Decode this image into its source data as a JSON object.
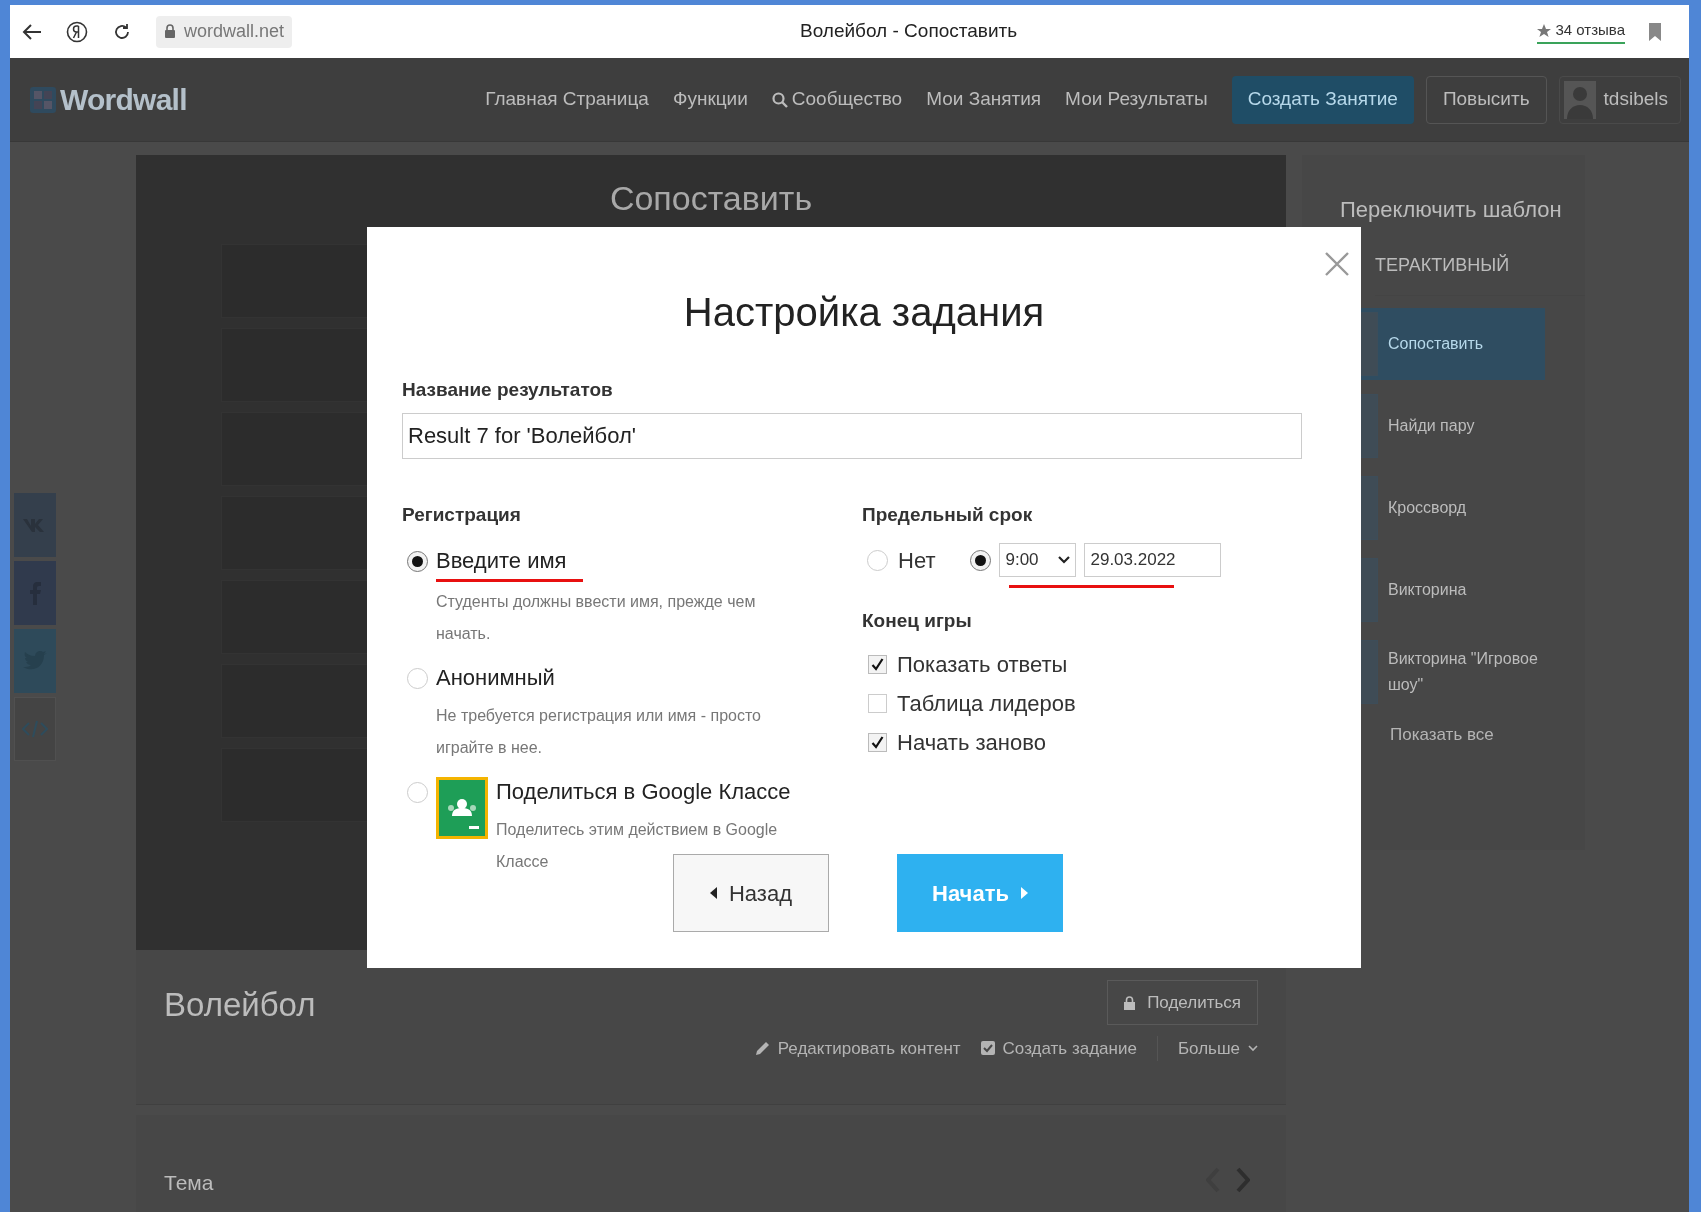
{
  "browser": {
    "address": "wordwall.net",
    "tab_title": "Волейбол - Сопоставить",
    "rating": "34 отзыва"
  },
  "navbar": {
    "logo": "Wordwall",
    "links": [
      {
        "label": "Главная Страница",
        "kind": "text"
      },
      {
        "label": "Функции",
        "kind": "text"
      },
      {
        "label": "Сообщество",
        "kind": "search"
      },
      {
        "label": "Мои Занятия",
        "kind": "text"
      },
      {
        "label": "Мои Результаты",
        "kind": "text"
      }
    ],
    "create_button": "Создать Занятие",
    "upgrade_button": "Повысить",
    "user": "tdsibels"
  },
  "game": {
    "title": "Сопоставить"
  },
  "sidebar": {
    "heading": "Переключить шаблон",
    "section": "ТЕРАКТИВНЫЙ",
    "templates": [
      {
        "label": "Сопоставить",
        "selected": true
      },
      {
        "label": "Найди пару",
        "selected": false
      },
      {
        "label": "Кроссворд",
        "selected": false
      },
      {
        "label": "Викторина",
        "selected": false
      },
      {
        "label": "Викторина \"Игровое шоу\"",
        "selected": false
      }
    ],
    "show_all": "Показать все"
  },
  "activity": {
    "title": "Волейбол",
    "share_button": "Поделиться",
    "actions": [
      {
        "label": "Редактировать контент",
        "kind": "edit"
      },
      {
        "label": "Создать задание",
        "kind": "task"
      },
      {
        "label": "Больше",
        "kind": "more"
      }
    ]
  },
  "topic": {
    "label": "Тема"
  },
  "dialog": {
    "title": "Настройка задания",
    "results_label": "Название результатов",
    "results_value": "Result 7 for 'Волейбол'",
    "registration": {
      "label": "Регистрация",
      "options": [
        {
          "kind": "radio",
          "label": "Введите имя",
          "description": "Студенты должны ввести имя, прежде чем начать.",
          "selected": true,
          "underlined": true
        },
        {
          "kind": "radio",
          "label": "Анонимный",
          "description": "Не требуется регистрация или имя - просто играйте в нее.",
          "selected": false,
          "underlined": false
        },
        {
          "kind": "google",
          "label": "Поделиться в Google Классе",
          "description": "Поделитесь этим действием в Google Классе",
          "selected": false,
          "underlined": false
        }
      ]
    },
    "deadline": {
      "label": "Предельный срок",
      "options": [
        {
          "kind": "none",
          "label": "Нет",
          "selected": false,
          "underlined": false
        },
        {
          "kind": "datetime",
          "time": "9:00",
          "date": "29.03.2022",
          "selected": true,
          "underlined": true
        }
      ]
    },
    "game_end": {
      "label": "Конец игры",
      "options": [
        {
          "label": "Показать ответы",
          "checked": true
        },
        {
          "label": "Таблица лидеров",
          "checked": false
        },
        {
          "label": "Начать заново",
          "checked": true
        }
      ]
    },
    "back_button": "Назад",
    "start_button": "Начать"
  }
}
